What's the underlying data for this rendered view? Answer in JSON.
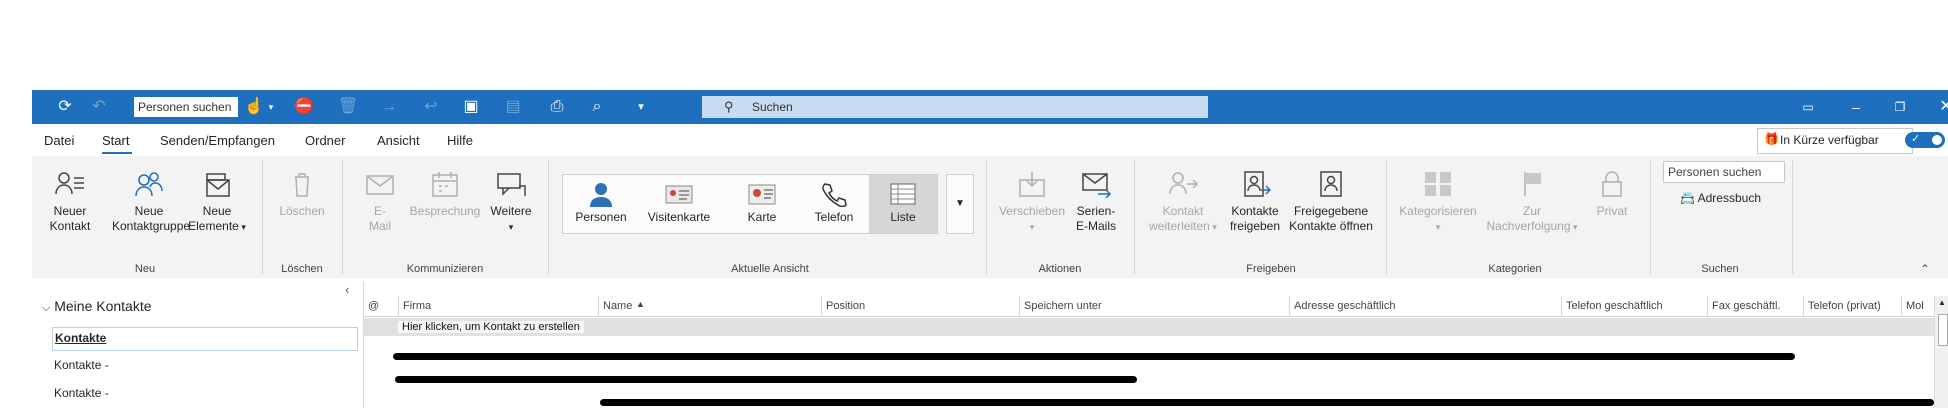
{
  "titlebar": {
    "people_search_placeholder": "Personen suchen",
    "search_placeholder": "Suchen",
    "icons": [
      "sync-icon",
      "undo-icon",
      "touch-mode-icon",
      "ignore-icon",
      "delete-icon",
      "forward-icon",
      "reply-icon",
      "move-icon",
      "rules-icon",
      "print-icon",
      "find-icon",
      "customize-icon"
    ]
  },
  "menu": {
    "tabs": [
      "Datei",
      "Start",
      "Senden/Empfangen",
      "Ordner",
      "Ansicht",
      "Hilfe"
    ],
    "active": "Start",
    "coming_soon": "In Kürze verfügbar"
  },
  "ribbon": {
    "new_contact": "Neuer Kontakt",
    "new_contact_l1": "Neuer",
    "new_contact_l2": "Kontakt",
    "new_group_l1": "Neue",
    "new_group_l2": "Kontaktgruppe",
    "new_items_l1": "Neue",
    "new_items_l2": "Elemente",
    "group_new": "Neu",
    "delete": "Löschen",
    "group_delete": "Löschen",
    "email_l1": "E-",
    "email_l2": "Mail",
    "meeting": "Besprechung",
    "more": "Weitere",
    "group_comm": "Kommunizieren",
    "views": [
      "Personen",
      "Visitenkarte",
      "Karte",
      "Telefon",
      "Liste"
    ],
    "active_view": "Liste",
    "group_view": "Aktuelle Ansicht",
    "move": "Verschieben",
    "mail_merge_l1": "Serien-",
    "mail_merge_l2": "E-Mails",
    "group_actions": "Aktionen",
    "forward_contact_l1": "Kontakt",
    "forward_contact_l2": "weiterleiten",
    "share_contacts_l1": "Kontakte",
    "share_contacts_l2": "freigeben",
    "open_shared_l1": "Freigegebene",
    "open_shared_l2": "Kontakte öffnen",
    "group_share": "Freigeben",
    "categorize": "Kategorisieren",
    "followup_l1": "Zur",
    "followup_l2": "Nachverfolgung",
    "private": "Privat",
    "group_tags": "Kategorien",
    "people_search": "Personen suchen",
    "address_book": "Adressbuch",
    "group_find": "Suchen"
  },
  "nav": {
    "heading": "Meine Kontakte",
    "items": [
      "Kontakte",
      "Kontakte -",
      "Kontakte -"
    ]
  },
  "list": {
    "columns": [
      "@",
      "Firma",
      "Name",
      "Position",
      "Speichern unter",
      "Adresse geschäftlich",
      "Telefon geschäftlich",
      "Fax geschäftl.",
      "Telefon (privat)",
      "Mol"
    ],
    "sort_indicator": "▲",
    "new_row": "Hier klicken, um Kontakt zu erstellen"
  },
  "colors": {
    "titlebar": "#1e6fbd",
    "search_box": "#c7dcf1",
    "ribbon": "#f3f3f3",
    "active_view": "#d6d6d6"
  }
}
